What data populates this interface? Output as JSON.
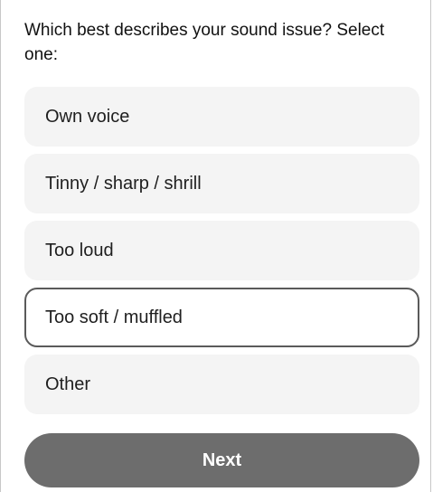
{
  "question": {
    "text": "Which best describes your sound issue? Select one:"
  },
  "options": [
    {
      "label": "Own voice",
      "selected": false
    },
    {
      "label": "Tinny / sharp / shrill",
      "selected": false
    },
    {
      "label": "Too loud",
      "selected": false
    },
    {
      "label": "Too soft / muffled",
      "selected": true
    },
    {
      "label": "Other",
      "selected": false
    }
  ],
  "next_button": {
    "label": "Next"
  },
  "colors": {
    "option_background": "#f4f4f4",
    "selected_border": "#5a5a5a",
    "button_background": "#6d6d6d",
    "button_text": "#ffffff"
  }
}
